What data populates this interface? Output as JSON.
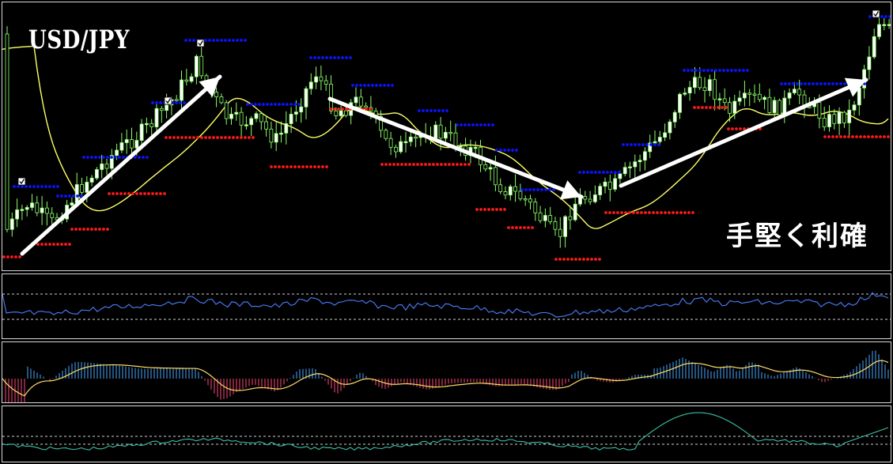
{
  "chart": {
    "symbol": "USD/JPY",
    "caption": "手堅く利確",
    "colors": {
      "background": "#000000",
      "candle_up_body": "#ffffff",
      "candle_down_body": "#000000",
      "candle_outline": "#8cff6a",
      "moving_average": "#ffff66",
      "resistance_dots": "#0a14ff",
      "support_dots": "#ff1a1a",
      "arrow": "#ffffff",
      "pane_border": "#d8d8d8",
      "osc1_line": "#4a7fff",
      "osc2_pos": "#4aa8ff",
      "osc2_neg": "#ff4a7a",
      "osc2_signal": "#ffdd66",
      "osc3_line": "#3cc0a8",
      "level_line": "#cfcfcf"
    },
    "icons": [
      "checkbox-checked-icon",
      "arrow-up-right-icon",
      "arrow-down-right-icon"
    ]
  }
}
